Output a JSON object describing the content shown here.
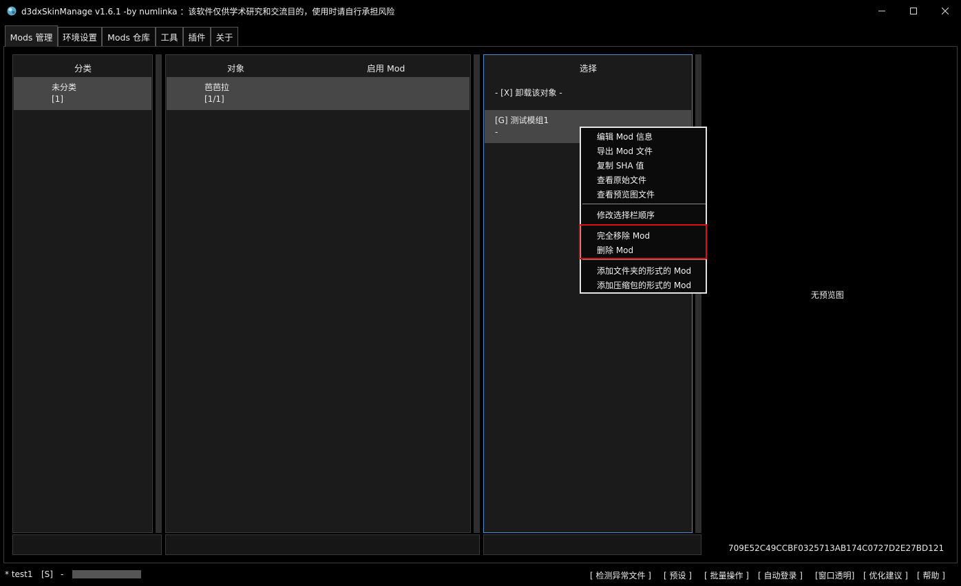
{
  "window": {
    "title": "d3dxSkinManage v1.6.1 -by numlinka ：该软件仅供学术研究和交流目的，使用时请自行承担风险",
    "minimize_glyph": "—",
    "maximize_glyph": "☐",
    "close_glyph": "✕"
  },
  "tabs": [
    {
      "label": "Mods 管理",
      "active": true
    },
    {
      "label": "环境设置"
    },
    {
      "label": "Mods 仓库"
    },
    {
      "label": "工具"
    },
    {
      "label": "插件"
    },
    {
      "label": "关于"
    }
  ],
  "category_panel": {
    "header": "分类",
    "items": [
      {
        "name": "未分类",
        "count": "[1]"
      }
    ]
  },
  "object_panel": {
    "header_object": "对象",
    "header_enabled": "启用 Mod",
    "items": [
      {
        "name": "芭芭拉",
        "count": "[1/1]"
      }
    ]
  },
  "selection_panel": {
    "header": "选择",
    "unload_label": "- [X] 卸载该对象 -",
    "items": [
      {
        "name": "[G] 测试模组1",
        "sub": "-"
      }
    ]
  },
  "context_menu": {
    "items": [
      "编辑 Mod 信息",
      "导出 Mod 文件",
      "复制 SHA 值",
      "查看原始文件",
      "查看预览图文件",
      "修改选择栏顺序",
      "完全移除 Mod",
      "删除 Mod",
      "添加文件夹的形式的 Mod",
      "添加压缩包的形式的 Mod"
    ]
  },
  "preview": {
    "placeholder": "无预览图",
    "sha": "709E52C49CCBF0325713AB174C0727D2E27BD121"
  },
  "status": {
    "user": "* test1",
    "mode": "[S]",
    "dash": "-",
    "links": [
      "[ 检测异常文件 ]",
      "[ 预设 ]",
      "[ 批量操作 ]",
      "[ 自动登录 ]",
      "[窗口透明]",
      "[ 优化建议 ]",
      "[ 帮助 ]"
    ]
  },
  "colors": {
    "background": "#000000",
    "panel": "#1b1b1b",
    "selected_row": "#474747",
    "focus_border": "#4a8fd6",
    "highlight_box": "#e01010"
  }
}
